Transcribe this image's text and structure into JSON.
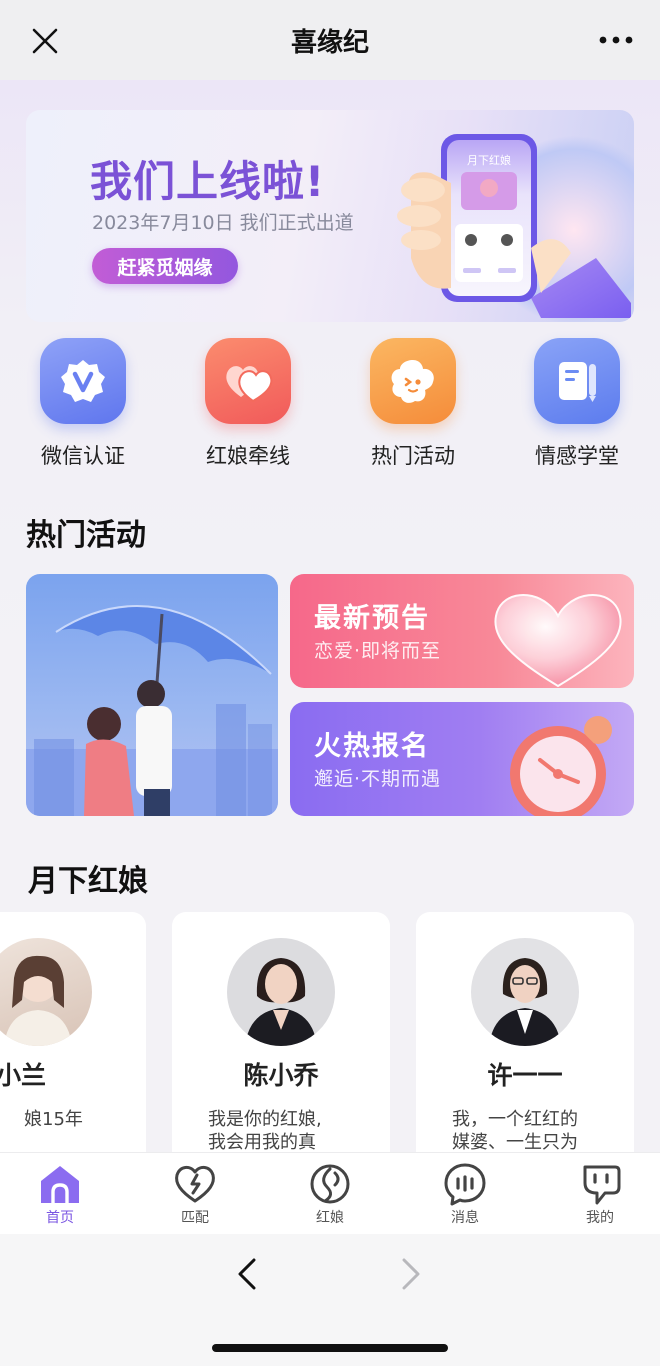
{
  "nav": {
    "title": "喜缘纪"
  },
  "banner": {
    "title": "我们上线啦!",
    "subtitle": "2023年7月10日 我们正式出道",
    "button": "赶紧觅姻缘",
    "phone_title": "月下红娘"
  },
  "quick_actions": [
    {
      "label": "微信认证",
      "icon": "verified-badge-icon",
      "color": "#6e86f4"
    },
    {
      "label": "红娘牵线",
      "icon": "hearts-icon",
      "color": "#f6705d"
    },
    {
      "label": "热门活动",
      "icon": "star-face-icon",
      "color": "#f8a048"
    },
    {
      "label": "情感学堂",
      "icon": "notebook-icon",
      "color": "#6b8cf3"
    }
  ],
  "hot_section": {
    "title": "热门活动"
  },
  "activities": [
    {
      "title": "最新预告",
      "subtitle": "恋爱·即将而至"
    },
    {
      "title": "火热报名",
      "subtitle": "邂逅·不期而遇"
    }
  ],
  "matchmaker_section": {
    "title": "月下红娘"
  },
  "matchmakers": [
    {
      "name": "小兰",
      "desc": "娘15年"
    },
    {
      "name": "陈小乔",
      "desc_line1": "我是你的红娘,",
      "desc_line2": "我会用我的真"
    },
    {
      "name": "许一一",
      "desc_line1": "我，一个红红的",
      "desc_line2": "媒婆、一生只为"
    }
  ],
  "tabs": [
    {
      "label": "首页",
      "icon": "home-icon",
      "active": true
    },
    {
      "label": "匹配",
      "icon": "match-heart-icon",
      "active": false
    },
    {
      "label": "红娘",
      "icon": "matchmaker-icon",
      "active": false
    },
    {
      "label": "消息",
      "icon": "message-icon",
      "active": false
    },
    {
      "label": "我的",
      "icon": "profile-icon",
      "active": false
    }
  ],
  "colors": {
    "accent": "#7a55e2",
    "banner_title": "#7b52d6"
  }
}
